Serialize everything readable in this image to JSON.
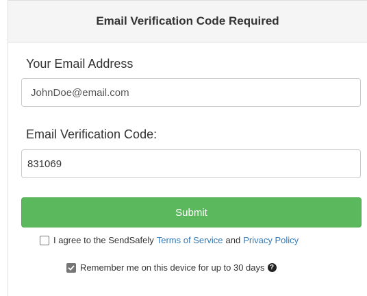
{
  "header": {
    "title": "Email Verification Code Required"
  },
  "form": {
    "email_label": "Your Email Address",
    "email_value": "JohnDoe@email.com",
    "code_label": "Email Verification Code:",
    "code_value": "831069",
    "submit_label": "Submit"
  },
  "agreement": {
    "checked": false,
    "prefix": "I agree to the SendSafely",
    "terms_link": "Terms of Service",
    "and": "and",
    "privacy_link": "Privacy Policy"
  },
  "remember": {
    "checked": true,
    "label": "Remember me on this device for up to 30 days",
    "help_icon": "question-circle-icon"
  },
  "colors": {
    "submit_bg": "#5cb85c",
    "link": "#337ab7",
    "header_bg": "#f5f5f5"
  }
}
